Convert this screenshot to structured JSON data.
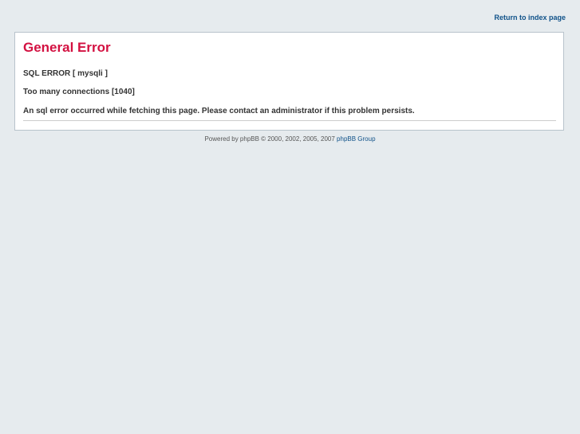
{
  "header": {
    "return_link_label": "Return to index page"
  },
  "error_panel": {
    "title": "General Error",
    "sql_error_line": "SQL ERROR [ mysqli ]",
    "detail_line": "Too many connections [1040]",
    "message_line": "An sql error occurred while fetching this page. Please contact an administrator if this problem persists."
  },
  "footer": {
    "powered_text": "Powered by phpBB © 2000, 2002, 2005, 2007",
    "group_link_label": "phpBB Group"
  },
  "colors": {
    "background": "#e6ebee",
    "title": "#d31141",
    "link": "#105289"
  }
}
